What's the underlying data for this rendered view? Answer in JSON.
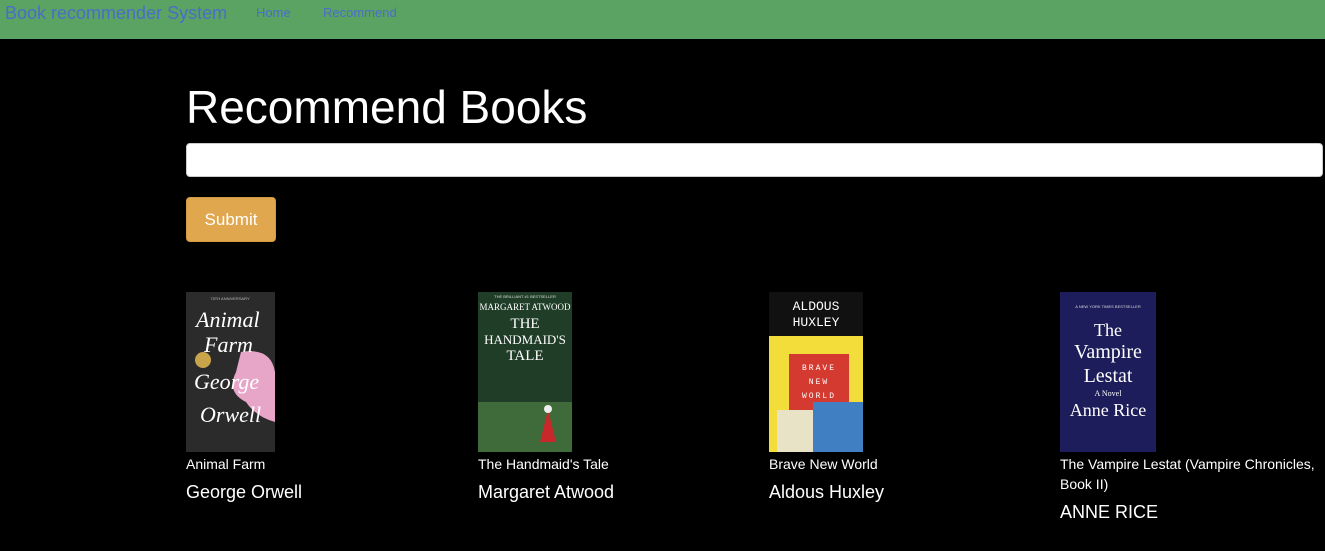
{
  "navbar": {
    "brand": "Book recommender System",
    "links": [
      "Home",
      "Recommend"
    ]
  },
  "main": {
    "heading": "Recommend Books",
    "search": {
      "value": "",
      "placeholder": ""
    },
    "submit_label": "Submit"
  },
  "books": [
    {
      "title": "Animal Farm",
      "author": "George Orwell",
      "cover_text": {
        "top": "75TH ANNIVERSARY",
        "line1": "Animal",
        "line2": "Farm",
        "line3": "George",
        "line4": "Orwell"
      }
    },
    {
      "title": "The Handmaid's Tale",
      "author": "Margaret Atwood",
      "cover_text": {
        "top": "THE BRILLIANT #1 BESTSELLER",
        "line1": "MARGARET ATWOOD",
        "line2": "THE",
        "line3": "HANDMAID'S",
        "line4": "TALE"
      }
    },
    {
      "title": "Brave New World",
      "author": "Aldous Huxley",
      "cover_text": {
        "line1": "ALDOUS",
        "line2": "HUXLEY",
        "line3": "BRAVE",
        "line4": "NEW",
        "line5": "WORLD"
      }
    },
    {
      "title": "The Vampire Lestat (Vampire Chronicles, Book II)",
      "author": "ANNE RICE",
      "cover_text": {
        "top": "A NEW YORK TIMES BESTSELLER",
        "line1": "The",
        "line2": "Vampire",
        "line3": "Lestat",
        "line4": "A Novel",
        "line5": "Anne Rice"
      }
    }
  ],
  "colors": {
    "navbar_bg": "#5ba363",
    "nav_link": "#4a6ec7",
    "page_bg": "#000000",
    "submit_bg": "#e0a74e"
  }
}
